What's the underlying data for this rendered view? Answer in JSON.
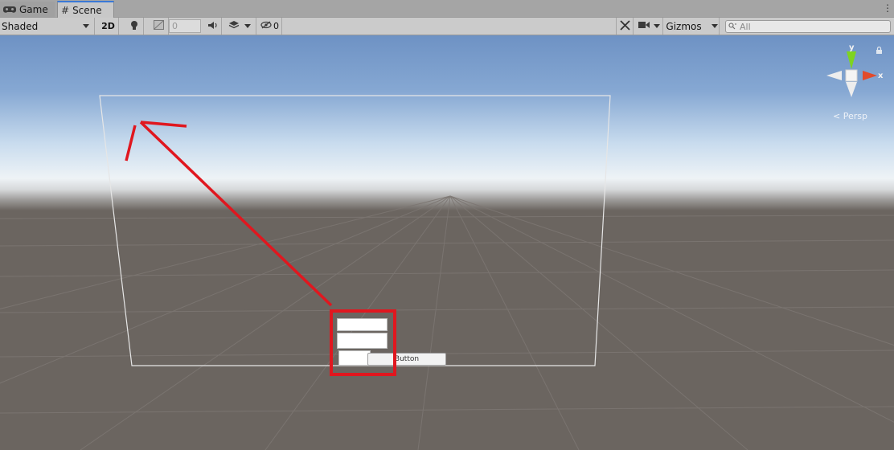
{
  "tabs": [
    {
      "label": "Game",
      "icon": "gamepad-icon",
      "active": false
    },
    {
      "label": "Scene",
      "icon": "grid-hash-icon",
      "active": true
    }
  ],
  "toolbar": {
    "shading_mode": "Shaded",
    "mode_2d": "2D",
    "fx_value": "0",
    "hidden_count": "0",
    "gizmos_label": "Gizmos",
    "search_placeholder": "All"
  },
  "scene": {
    "gizmo_axis_y": "y",
    "gizmo_axis_x": "x",
    "projection_label": "Persp",
    "ui_button_label": "Button"
  },
  "colors": {
    "annotation_red": "#e0171f",
    "gizmo_y": "#7ed321",
    "gizmo_x": "#e24a2b",
    "tab_accent": "#3a79d6"
  }
}
